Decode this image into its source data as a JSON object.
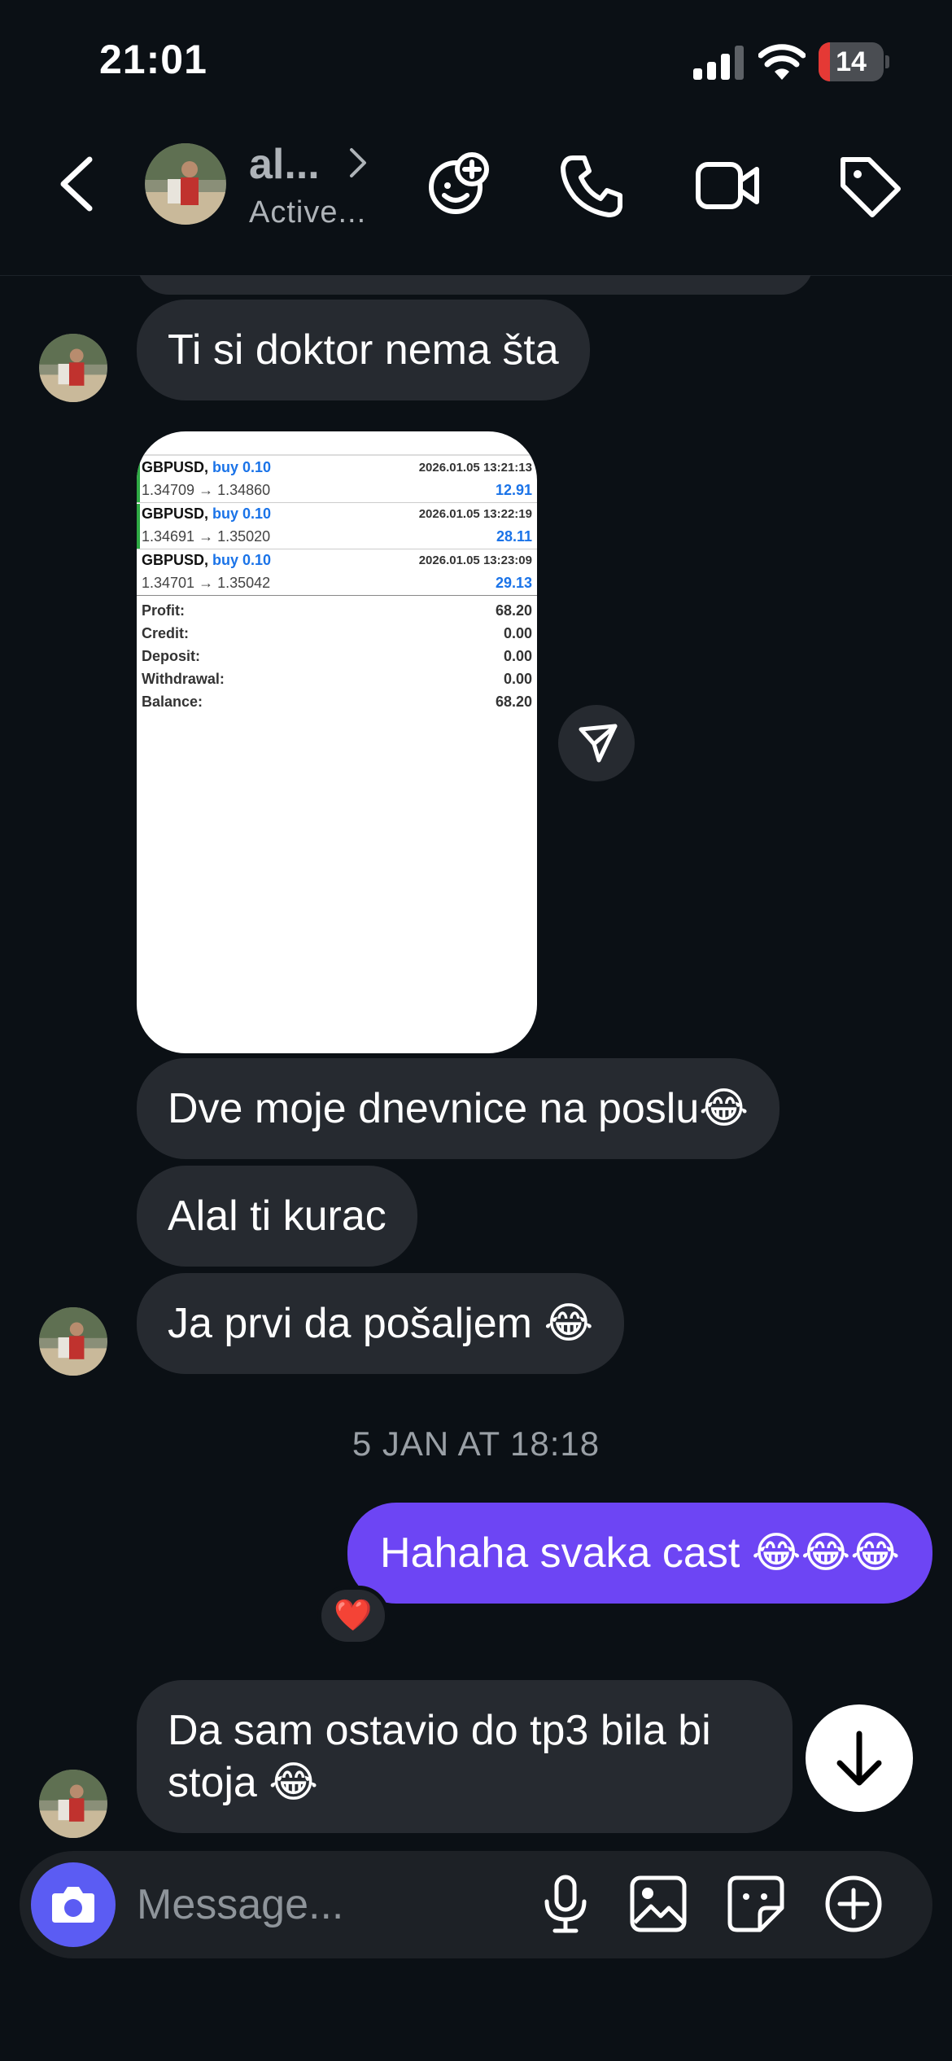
{
  "status_bar": {
    "time": "21:01",
    "battery": "14"
  },
  "header": {
    "name": "al...",
    "status": "Active..."
  },
  "messages": [
    {
      "text": "Ti si doktor nema šta"
    },
    {
      "text": "Dve moje dnevnice na poslu😂"
    },
    {
      "text": "Alal ti kurac"
    },
    {
      "text": "Ja prvi da pošaljem 😂"
    },
    {
      "text": "Hahaha svaka cast 😂😂😂"
    },
    {
      "text_line1": "Da sam ostavio do tp3 bila bi",
      "text_line2": "stoja 😂"
    }
  ],
  "date_separator": "5 JAN AT 18:18",
  "reaction": "❤️",
  "screenshot": {
    "trades": [
      {
        "symbol": "GBPUSD,",
        "type": "buy 0.10",
        "date": "2026.01.05 13:21:13",
        "prices": "1.34709 → 1.34860",
        "profit": "12.91"
      },
      {
        "symbol": "GBPUSD,",
        "type": "buy 0.10",
        "date": "2026.01.05 13:22:19",
        "prices": "1.34691 → 1.35020",
        "profit": "28.11"
      },
      {
        "symbol": "GBPUSD,",
        "type": "buy 0.10",
        "date": "2026.01.05 13:23:09",
        "prices": "1.34701 → 1.35042",
        "profit": "29.13"
      }
    ],
    "summary": [
      {
        "label": "Profit:",
        "value": "68.20"
      },
      {
        "label": "Credit:",
        "value": "0.00"
      },
      {
        "label": "Deposit:",
        "value": "0.00"
      },
      {
        "label": "Withdrawal:",
        "value": "0.00"
      },
      {
        "label": "Balance:",
        "value": "68.20"
      }
    ]
  },
  "composer": {
    "placeholder": "Message..."
  },
  "colors": {
    "background": "#0b1015",
    "incoming_bubble": "#262a30",
    "outgoing_bubble": "#6d45f4",
    "camera_button": "#5b5cf3"
  },
  "icons": [
    "back-icon",
    "chevron-right-icon",
    "effects-icon",
    "phone-icon",
    "video-icon",
    "tag-icon",
    "share-icon",
    "arrow-down-icon",
    "camera-icon",
    "microphone-icon",
    "gallery-icon",
    "sticker-icon",
    "plus-icon"
  ]
}
